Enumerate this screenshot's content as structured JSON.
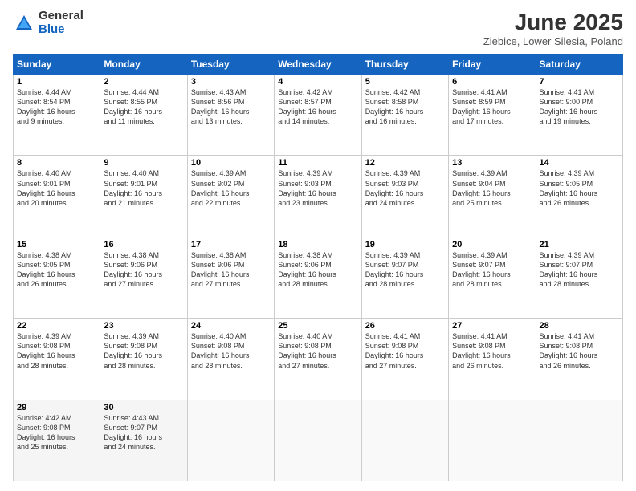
{
  "header": {
    "logo_general": "General",
    "logo_blue": "Blue",
    "month_year": "June 2025",
    "location": "Ziebice, Lower Silesia, Poland"
  },
  "weekdays": [
    "Sunday",
    "Monday",
    "Tuesday",
    "Wednesday",
    "Thursday",
    "Friday",
    "Saturday"
  ],
  "weeks": [
    [
      {
        "day": "1",
        "rise": "4:44 AM",
        "set": "8:54 PM",
        "light": "16 hours and 9 minutes."
      },
      {
        "day": "2",
        "rise": "4:44 AM",
        "set": "8:55 PM",
        "light": "16 hours and 11 minutes."
      },
      {
        "day": "3",
        "rise": "4:43 AM",
        "set": "8:56 PM",
        "light": "16 hours and 13 minutes."
      },
      {
        "day": "4",
        "rise": "4:42 AM",
        "set": "8:57 PM",
        "light": "16 hours and 14 minutes."
      },
      {
        "day": "5",
        "rise": "4:42 AM",
        "set": "8:58 PM",
        "light": "16 hours and 16 minutes."
      },
      {
        "day": "6",
        "rise": "4:41 AM",
        "set": "8:59 PM",
        "light": "16 hours and 17 minutes."
      },
      {
        "day": "7",
        "rise": "4:41 AM",
        "set": "9:00 PM",
        "light": "16 hours and 19 minutes."
      }
    ],
    [
      {
        "day": "8",
        "rise": "4:40 AM",
        "set": "9:01 PM",
        "light": "16 hours and 20 minutes."
      },
      {
        "day": "9",
        "rise": "4:40 AM",
        "set": "9:01 PM",
        "light": "16 hours and 21 minutes."
      },
      {
        "day": "10",
        "rise": "4:39 AM",
        "set": "9:02 PM",
        "light": "16 hours and 22 minutes."
      },
      {
        "day": "11",
        "rise": "4:39 AM",
        "set": "9:03 PM",
        "light": "16 hours and 23 minutes."
      },
      {
        "day": "12",
        "rise": "4:39 AM",
        "set": "9:03 PM",
        "light": "16 hours and 24 minutes."
      },
      {
        "day": "13",
        "rise": "4:39 AM",
        "set": "9:04 PM",
        "light": "16 hours and 25 minutes."
      },
      {
        "day": "14",
        "rise": "4:39 AM",
        "set": "9:05 PM",
        "light": "16 hours and 26 minutes."
      }
    ],
    [
      {
        "day": "15",
        "rise": "4:38 AM",
        "set": "9:05 PM",
        "light": "16 hours and 26 minutes."
      },
      {
        "day": "16",
        "rise": "4:38 AM",
        "set": "9:06 PM",
        "light": "16 hours and 27 minutes."
      },
      {
        "day": "17",
        "rise": "4:38 AM",
        "set": "9:06 PM",
        "light": "16 hours and 27 minutes."
      },
      {
        "day": "18",
        "rise": "4:38 AM",
        "set": "9:06 PM",
        "light": "16 hours and 28 minutes."
      },
      {
        "day": "19",
        "rise": "4:39 AM",
        "set": "9:07 PM",
        "light": "16 hours and 28 minutes."
      },
      {
        "day": "20",
        "rise": "4:39 AM",
        "set": "9:07 PM",
        "light": "16 hours and 28 minutes."
      },
      {
        "day": "21",
        "rise": "4:39 AM",
        "set": "9:07 PM",
        "light": "16 hours and 28 minutes."
      }
    ],
    [
      {
        "day": "22",
        "rise": "4:39 AM",
        "set": "9:08 PM",
        "light": "16 hours and 28 minutes."
      },
      {
        "day": "23",
        "rise": "4:39 AM",
        "set": "9:08 PM",
        "light": "16 hours and 28 minutes."
      },
      {
        "day": "24",
        "rise": "4:40 AM",
        "set": "9:08 PM",
        "light": "16 hours and 28 minutes."
      },
      {
        "day": "25",
        "rise": "4:40 AM",
        "set": "9:08 PM",
        "light": "16 hours and 27 minutes."
      },
      {
        "day": "26",
        "rise": "4:41 AM",
        "set": "9:08 PM",
        "light": "16 hours and 27 minutes."
      },
      {
        "day": "27",
        "rise": "4:41 AM",
        "set": "9:08 PM",
        "light": "16 hours and 26 minutes."
      },
      {
        "day": "28",
        "rise": "4:41 AM",
        "set": "9:08 PM",
        "light": "16 hours and 26 minutes."
      }
    ],
    [
      {
        "day": "29",
        "rise": "4:42 AM",
        "set": "9:08 PM",
        "light": "16 hours and 25 minutes."
      },
      {
        "day": "30",
        "rise": "4:43 AM",
        "set": "9:07 PM",
        "light": "16 hours and 24 minutes."
      },
      null,
      null,
      null,
      null,
      null
    ]
  ]
}
